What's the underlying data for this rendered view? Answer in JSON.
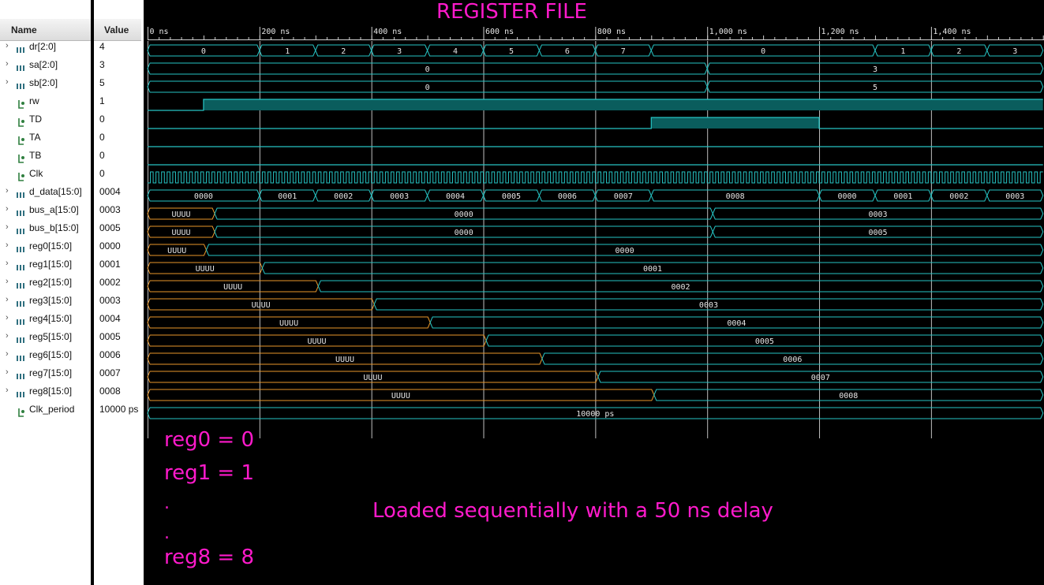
{
  "title": "REGISTER FILE",
  "columns": {
    "name": "Name",
    "value": "Value"
  },
  "ruler": {
    "ticks": [
      {
        "t": 0,
        "label": "0 ns"
      },
      {
        "t": 200,
        "label": "200 ns"
      },
      {
        "t": 400,
        "label": "400 ns"
      },
      {
        "t": 600,
        "label": "600 ns"
      },
      {
        "t": 800,
        "label": "800 ns"
      },
      {
        "t": 1000,
        "label": "1,000 ns"
      },
      {
        "t": 1200,
        "label": "1,200 ns"
      },
      {
        "t": 1400,
        "label": "1,400 ns"
      }
    ]
  },
  "colors": {
    "wave": "#26c4c4",
    "undef": "#e8962a",
    "fill": "#0a5d5d",
    "grid": "#cfcfcf",
    "annotation": "#ff1acb"
  },
  "signals": [
    {
      "name": "dr[2:0]",
      "value": "4",
      "kind": "bus",
      "segments": [
        [
          0,
          200,
          "0"
        ],
        [
          200,
          300,
          "1"
        ],
        [
          300,
          400,
          "2"
        ],
        [
          400,
          500,
          "3"
        ],
        [
          500,
          600,
          "4"
        ],
        [
          600,
          700,
          "5"
        ],
        [
          700,
          800,
          "6"
        ],
        [
          800,
          900,
          "7"
        ],
        [
          900,
          1300,
          "0"
        ],
        [
          1300,
          1400,
          "1"
        ],
        [
          1400,
          1500,
          "2"
        ],
        [
          1500,
          1600,
          "3"
        ]
      ]
    },
    {
      "name": "sa[2:0]",
      "value": "3",
      "kind": "bus",
      "segments": [
        [
          0,
          1000,
          "0"
        ],
        [
          1000,
          1600,
          "3"
        ]
      ]
    },
    {
      "name": "sb[2:0]",
      "value": "5",
      "kind": "bus",
      "segments": [
        [
          0,
          1000,
          "0"
        ],
        [
          1000,
          1600,
          "5"
        ]
      ]
    },
    {
      "name": "rw",
      "value": "1",
      "kind": "bit",
      "levels": [
        [
          0,
          100,
          0
        ],
        [
          100,
          1600,
          1
        ]
      ]
    },
    {
      "name": "TD",
      "value": "0",
      "kind": "bit",
      "levels": [
        [
          0,
          900,
          0
        ],
        [
          900,
          1200,
          1
        ],
        [
          1200,
          1600,
          0
        ]
      ]
    },
    {
      "name": "TA",
      "value": "0",
      "kind": "bit",
      "levels": [
        [
          0,
          1600,
          0
        ]
      ]
    },
    {
      "name": "TB",
      "value": "0",
      "kind": "bit",
      "levels": [
        [
          0,
          1600,
          0
        ]
      ]
    },
    {
      "name": "Clk",
      "value": "0",
      "kind": "clock",
      "period": 10
    },
    {
      "name": "d_data[15:0]",
      "value": "0004",
      "kind": "bus",
      "segments": [
        [
          0,
          200,
          "0000"
        ],
        [
          200,
          300,
          "0001"
        ],
        [
          300,
          400,
          "0002"
        ],
        [
          400,
          500,
          "0003"
        ],
        [
          500,
          600,
          "0004"
        ],
        [
          600,
          700,
          "0005"
        ],
        [
          700,
          800,
          "0006"
        ],
        [
          800,
          900,
          "0007"
        ],
        [
          900,
          1200,
          "0008"
        ],
        [
          1200,
          1300,
          "0000"
        ],
        [
          1300,
          1400,
          "0001"
        ],
        [
          1400,
          1500,
          "0002"
        ],
        [
          1500,
          1600,
          "0003"
        ]
      ]
    },
    {
      "name": "bus_a[15:0]",
      "value": "0003",
      "kind": "bus",
      "segments": [
        [
          0,
          120,
          "UUUU",
          "u"
        ],
        [
          120,
          1010,
          "0000"
        ],
        [
          1010,
          1600,
          "0003"
        ]
      ]
    },
    {
      "name": "bus_b[15:0]",
      "value": "0005",
      "kind": "bus",
      "segments": [
        [
          0,
          120,
          "UUUU",
          "u"
        ],
        [
          120,
          1010,
          "0000"
        ],
        [
          1010,
          1600,
          "0005"
        ]
      ]
    },
    {
      "name": "reg0[15:0]",
      "value": "0000",
      "kind": "bus",
      "segments": [
        [
          0,
          105,
          "UUUU",
          "u"
        ],
        [
          105,
          1600,
          "0000"
        ]
      ]
    },
    {
      "name": "reg1[15:0]",
      "value": "0001",
      "kind": "bus",
      "segments": [
        [
          0,
          205,
          "UUUU",
          "u"
        ],
        [
          205,
          1600,
          "0001"
        ]
      ]
    },
    {
      "name": "reg2[15:0]",
      "value": "0002",
      "kind": "bus",
      "segments": [
        [
          0,
          305,
          "UUUU",
          "u"
        ],
        [
          305,
          1600,
          "0002"
        ]
      ]
    },
    {
      "name": "reg3[15:0]",
      "value": "0003",
      "kind": "bus",
      "segments": [
        [
          0,
          405,
          "UUUU",
          "u"
        ],
        [
          405,
          1600,
          "0003"
        ]
      ]
    },
    {
      "name": "reg4[15:0]",
      "value": "0004",
      "kind": "bus",
      "segments": [
        [
          0,
          505,
          "UUUU",
          "u"
        ],
        [
          505,
          1600,
          "0004"
        ]
      ]
    },
    {
      "name": "reg5[15:0]",
      "value": "0005",
      "kind": "bus",
      "segments": [
        [
          0,
          605,
          "UUUU",
          "u"
        ],
        [
          605,
          1600,
          "0005"
        ]
      ]
    },
    {
      "name": "reg6[15:0]",
      "value": "0006",
      "kind": "bus",
      "segments": [
        [
          0,
          705,
          "UUUU",
          "u"
        ],
        [
          705,
          1600,
          "0006"
        ]
      ]
    },
    {
      "name": "reg7[15:0]",
      "value": "0007",
      "kind": "bus",
      "segments": [
        [
          0,
          805,
          "UUUU",
          "u"
        ],
        [
          805,
          1600,
          "0007"
        ]
      ]
    },
    {
      "name": "reg8[15:0]",
      "value": "0008",
      "kind": "bus",
      "segments": [
        [
          0,
          905,
          "UUUU",
          "u"
        ],
        [
          905,
          1600,
          "0008"
        ]
      ]
    },
    {
      "name": "Clk_period",
      "value": "10000 ps",
      "kind": "bus",
      "noexpand": true,
      "segments": [
        [
          0,
          1600,
          "10000 ps"
        ]
      ]
    }
  ],
  "annotations": {
    "line1": "reg0 = 0",
    "line2": "reg1 = 1",
    "dot1": ".",
    "dot2": ".",
    "line3": "reg8 = 8",
    "note": "Loaded sequentially with a 50 ns delay"
  }
}
